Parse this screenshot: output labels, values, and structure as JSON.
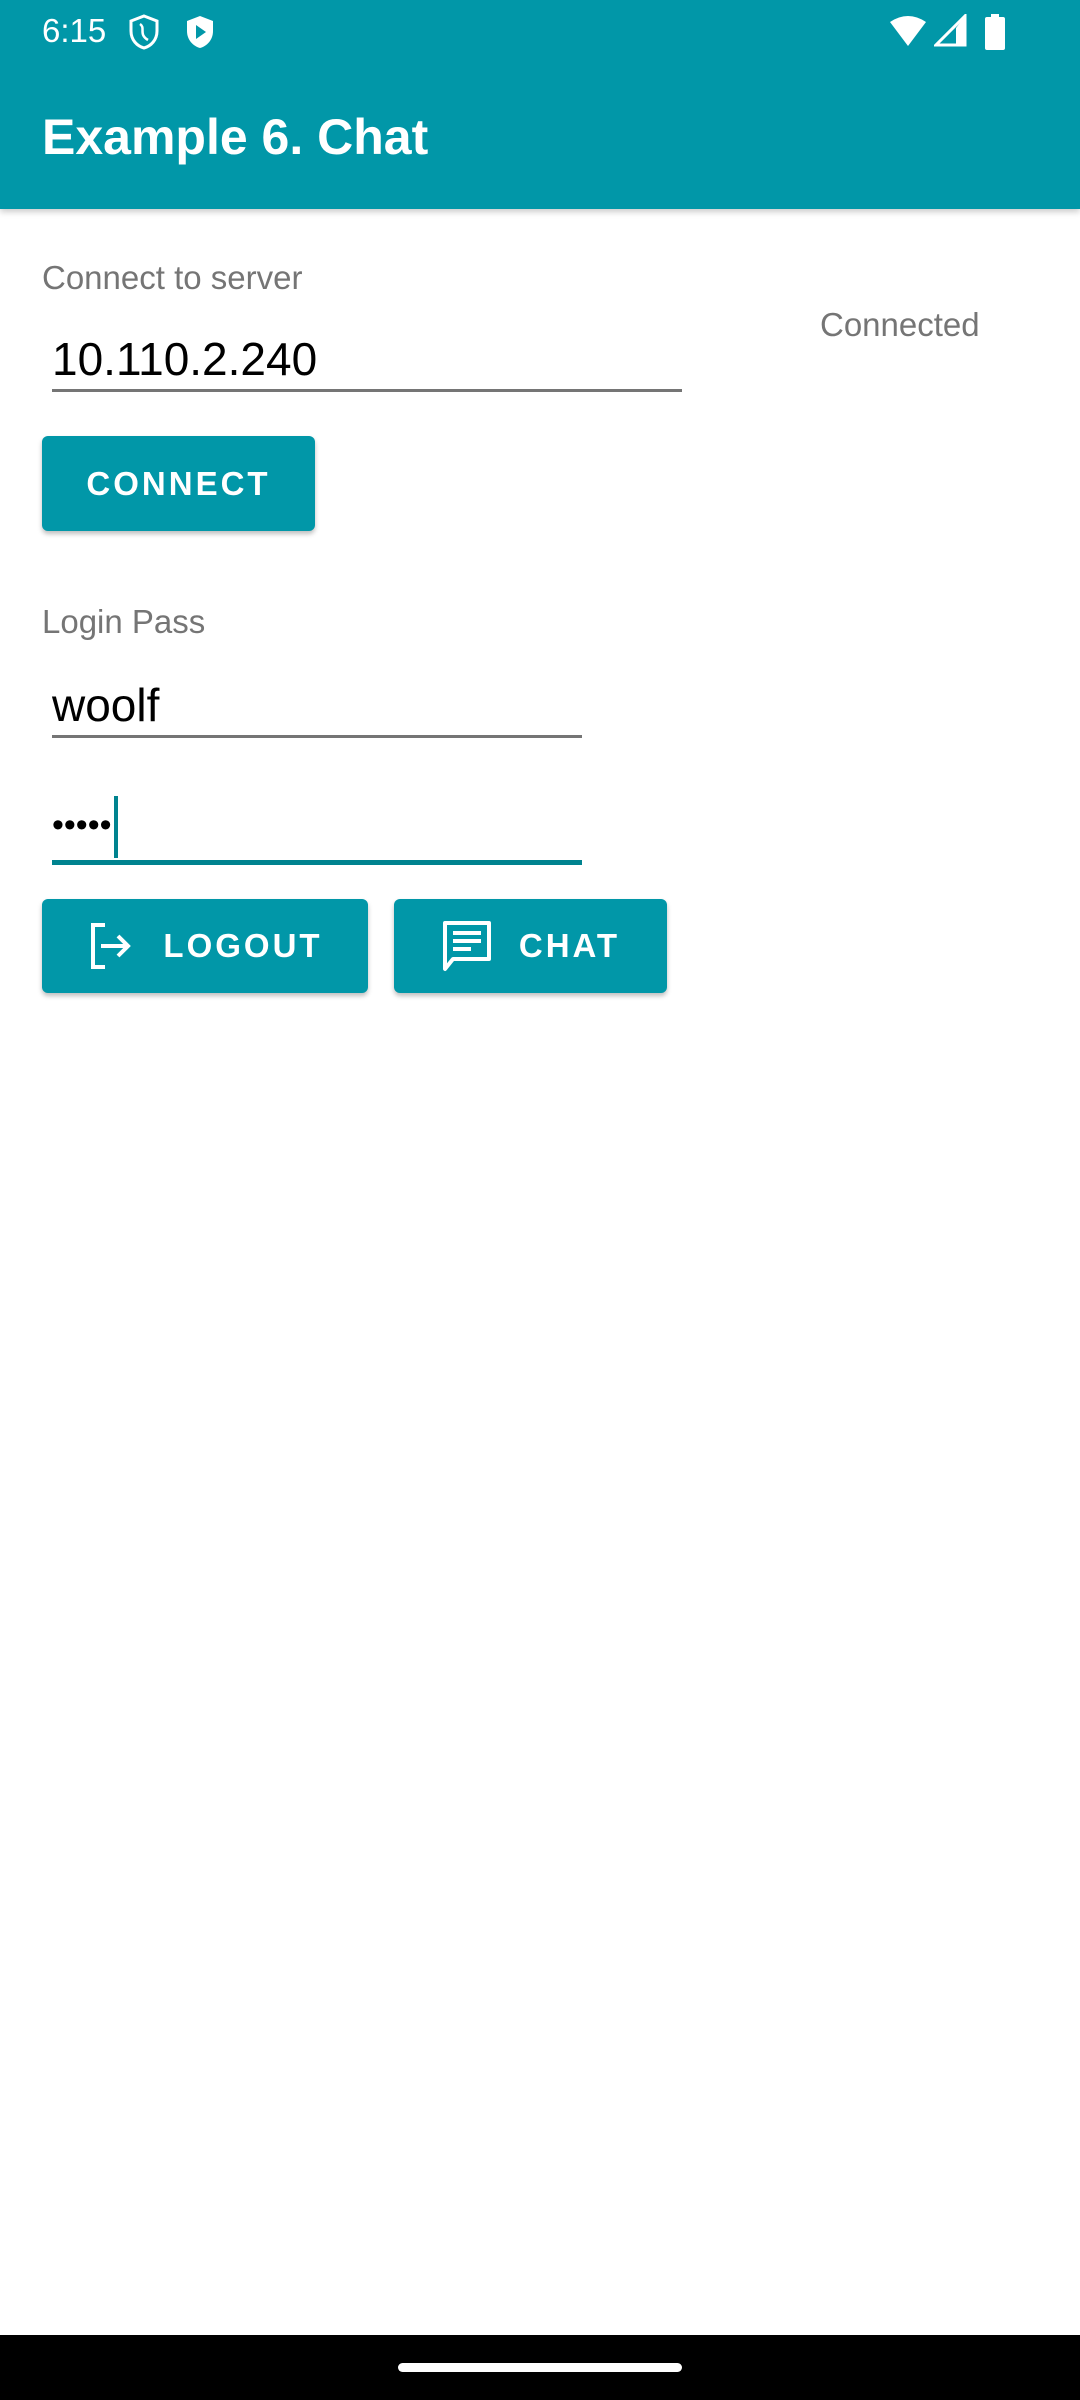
{
  "status_bar": {
    "time": "6:15",
    "icons": [
      "shield-icon",
      "play-shield-icon",
      "wifi-icon",
      "signal-icon",
      "battery-icon"
    ]
  },
  "app_bar": {
    "title": "Example 6. Chat"
  },
  "server": {
    "label": "Connect to server",
    "value": "10.110.2.240",
    "status": "Connected",
    "connect_label": "CONNECT"
  },
  "login": {
    "label": "Login Pass",
    "username": "woolf",
    "password_masked": "•••••"
  },
  "actions": {
    "logout_label": "LOGOUT",
    "chat_label": "CHAT"
  },
  "colors": {
    "primary": "#0197a8",
    "accent": "#00838f"
  }
}
